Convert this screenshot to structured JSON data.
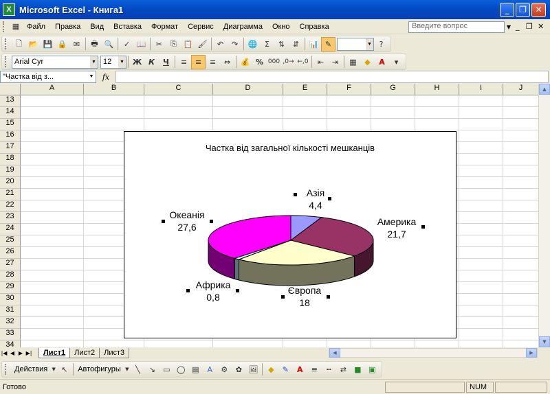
{
  "window": {
    "title": "Microsoft Excel - Книга1",
    "app_icon_letter": "X"
  },
  "menu": {
    "items": [
      "Файл",
      "Правка",
      "Вид",
      "Вставка",
      "Формат",
      "Сервис",
      "Диаграмма",
      "Окно",
      "Справка"
    ],
    "help_placeholder": "Введите вопрос"
  },
  "format_bar": {
    "font": "Arial Cyr",
    "size": "12",
    "bold": "Ж",
    "italic": "К",
    "underline": "Ч",
    "percent": "%",
    "thousands": "000"
  },
  "formula_bar": {
    "name_box": "\"Частка від з...",
    "fx": "fx",
    "content": ""
  },
  "columns": [
    "A",
    "B",
    "C",
    "D",
    "E",
    "F",
    "G",
    "H",
    "I",
    "J"
  ],
  "rows": [
    "13",
    "14",
    "15",
    "16",
    "17",
    "18",
    "19",
    "20",
    "21",
    "22",
    "23",
    "24",
    "25",
    "26",
    "27",
    "28",
    "29",
    "30",
    "31",
    "32",
    "33",
    "34"
  ],
  "chart_data": {
    "type": "pie",
    "style": "3d-pie",
    "title": "Частка від загальної кількості мешканців",
    "categories": [
      "Азія",
      "Америка",
      "Європа",
      "Африка",
      "Океанія"
    ],
    "values": [
      4.4,
      21.7,
      18,
      0.8,
      27.6
    ],
    "labels": [
      "4,4",
      "21,7",
      "18",
      "0,8",
      "27,6"
    ],
    "colors": [
      "#9999ff",
      "#993366",
      "#ffffcc",
      "#ccffff",
      "#ff00ff"
    ]
  },
  "sheets": {
    "tabs": [
      "Лист1",
      "Лист2",
      "Лист3"
    ],
    "active": "Лист1"
  },
  "drawing": {
    "actions": "Действия",
    "autoshapes": "Автофигуры"
  },
  "status": {
    "text": "Готово",
    "num": "NUM"
  }
}
